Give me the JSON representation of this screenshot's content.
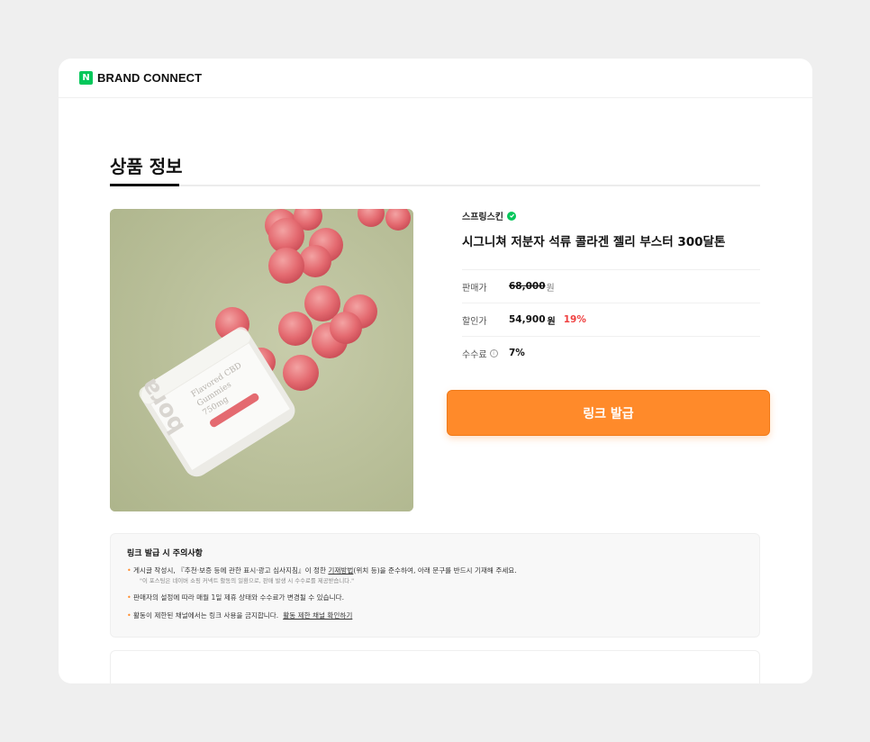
{
  "header": {
    "logo_mark": "N",
    "brand": "BRAND CONNECT"
  },
  "section": {
    "title": "상품 정보"
  },
  "product": {
    "seller": "스프링스킨",
    "name": "시그니쳐 저분자 석류 콜라겐 젤리 부스터 300달톤",
    "image_icon": "product-photo-gummies",
    "jar_label": [
      "bora",
      "Flavored CBD",
      "Gummies",
      "750mg"
    ]
  },
  "price_rows": {
    "list_label": "판매가",
    "list_price": "68,000",
    "list_unit": "원",
    "sale_label": "할인가",
    "sale_price": "54,900",
    "sale_unit": "원",
    "discount": "19%",
    "fee_label": "수수료",
    "fee_value": "7%"
  },
  "button": {
    "label": "링크 발급"
  },
  "notice": {
    "title": "링크 발급 시 주의사항",
    "item1_pre": "게시글 작성시, 『추천·보증 등에 관한 표시·광고 심사지침』이 정한 ",
    "item1_link": "기재방법",
    "item1_post": "(위치 등)을 준수하여, 아래 문구를 반드시 기재해 주세요.",
    "item1_sub": "\"이 포스팅은 네이버 쇼핑 커넥트 활동의 일환으로, 판매 발생 시 수수료를 제공받습니다.\"",
    "item2": "판매자의 설정에 따라 매월 1일 제휴 상태와 수수료가 변경될 수 있습니다.",
    "item3": "활동이 제한된 채널에서는 링크 사용을 금지합니다.",
    "item3_link": "활동 제한 채널 확인하기"
  },
  "colors": {
    "accent": "#ff8a2a",
    "brand_green": "#03c75a",
    "discount_red": "#ef4040"
  }
}
